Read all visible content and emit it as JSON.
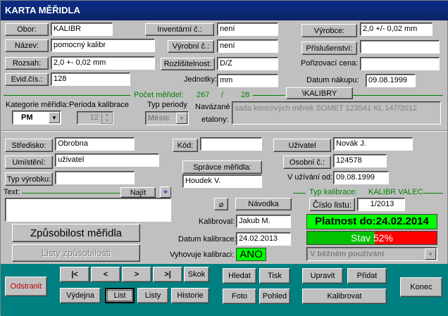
{
  "window": {
    "title": "KARTA MĚŘIDLA"
  },
  "left": {
    "obor_btn": "Obor:",
    "obor_val": "KALIBR",
    "nazev_btn": "Název:",
    "nazev_val": "pomocný kalibr",
    "rozsah_btn": "Rozsah:",
    "rozsah_val": "2,0 +- 0,02 mm",
    "evid_btn": "Evid.čís.:",
    "evid_val": "128"
  },
  "mid": {
    "inv_btn": "Inventární č.:",
    "inv_val": "není",
    "vyr_btn": "Výrobní č.:",
    "vyr_val": "není",
    "rozl_btn": "Rozlišitelnost:",
    "rozl_val": "D/Z",
    "jednotky_lbl": "Jednotky:",
    "jednotky_val": "mm"
  },
  "right": {
    "vyrobce_btn": "Výrobce:",
    "vyrobce_val": "2,0 +/- 0,02 mm",
    "prisl_btn": "Příslušenství:",
    "prisl_val": "",
    "cena_lbl": "Pořizovací cena:",
    "cena_val": "",
    "datum_lbl": "Datum nákupu:",
    "datum_val": "09.08.1999"
  },
  "pocet": {
    "label": "Počet měřidel:",
    "a": "267",
    "sep": "/",
    "b": "28",
    "kalibry_btn": "\\KALIBRY"
  },
  "kategorie": {
    "label": "Kategorie měřidla:",
    "value": "PM",
    "perioda_lbl": "Perioda kalibrace",
    "perioda_val": "12",
    "typ_lbl": "Typ periody",
    "typ_val": "Měsíc",
    "navaz_lbl1": "Navázané",
    "navaz_lbl2": "etalony:",
    "navaz_val": "sada koncových měrek SOMET 123541 KL 147/2012"
  },
  "mid2": {
    "stredisko_btn": "Středisko:",
    "stredisko_val": "Obrobna",
    "umisteni_btn": "Umístění:",
    "umisteni_val": "uživatel",
    "typvyr_btn": "Typ výrobku:",
    "typvyr_val": "",
    "kod_btn": "Kód:",
    "kod_val": "",
    "spravce_btn": "Správce měřidla:",
    "spravce_val": "Houdek V.",
    "uzivatel_btn": "Uživatel",
    "uzivatel_val": "Novák J.",
    "osobni_btn": "Osobní č.:",
    "osobni_val": "124578",
    "vuzivani_lbl": "V užívání od:",
    "vuzivani_val": "09.08.1999"
  },
  "text": {
    "label": "Text:",
    "najit_btn": "Najít",
    "value": ""
  },
  "kalib": {
    "typ_lbl": "Typ kalibrace:",
    "typ_val": "KALIBR VALEC",
    "cislo_btn": "Číslo listu:",
    "cislo_val": "1/2013",
    "navodka_btn": "Návodka",
    "kalibroval_lbl": "Kalibroval:",
    "kalibroval_val": "Jakub M.",
    "datum_lbl": "Datum kalibrace:",
    "datum_val": "24.02.2013",
    "vyhovuje_lbl": "Vyhovuje kalibraci:",
    "vyhovuje_val": "ANO",
    "platnost": "Platnost do:24.02.2014",
    "stav_lbl": "Stav",
    "stav_pct": "52%",
    "stav_fraction": 0.52,
    "stav_combo": "V běžném používání"
  },
  "buttons": {
    "zpusobilost": "Způsobilost měřidla",
    "listy_zpus": "Listy způsobilosti",
    "odstranit": "Odstranit",
    "first": "|<",
    "prev": "<",
    "next": ">",
    "last": ">|",
    "skok": "Skok",
    "vydejna": "Výdejna",
    "list": "List",
    "listy": "Listy",
    "historie": "Historie",
    "hledat": "Hledat",
    "tisk": "Tisk",
    "foto": "Foto",
    "pohled": "Pohled",
    "upravit": "Upravit",
    "pridat": "Přidat",
    "kalibrovat": "Kalibrovat",
    "konec": "Konec"
  },
  "colors": {
    "title": "#0a246a",
    "green_box": "#00ff00",
    "red_bar": "#ff0000",
    "nav_bg": "#008080",
    "group_line": "#008000"
  }
}
